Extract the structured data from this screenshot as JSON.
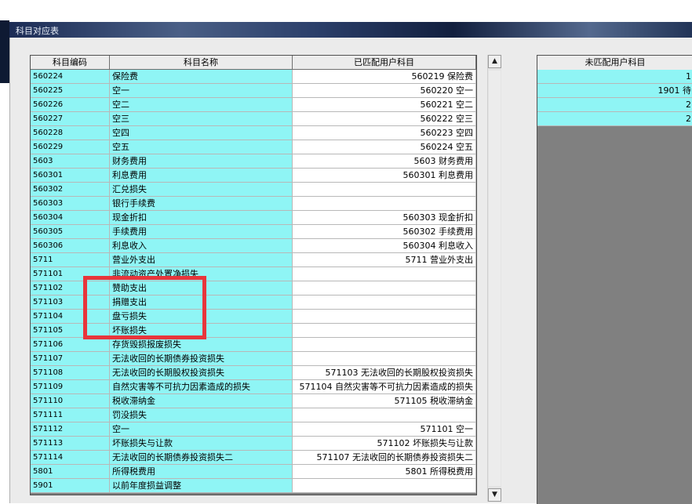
{
  "window": {
    "title": "科目对应表"
  },
  "left_table": {
    "headers": [
      "科目编码",
      "科目名称",
      "已匹配用户科目"
    ],
    "rows": [
      {
        "code": "560224",
        "name": "保险费",
        "matched": "560219 保险费"
      },
      {
        "code": "560225",
        "name": "空一",
        "matched": "560220 空一"
      },
      {
        "code": "560226",
        "name": "空二",
        "matched": "560221 空二"
      },
      {
        "code": "560227",
        "name": "空三",
        "matched": "560222 空三"
      },
      {
        "code": "560228",
        "name": "空四",
        "matched": "560223 空四"
      },
      {
        "code": "560229",
        "name": "空五",
        "matched": "560224 空五"
      },
      {
        "code": "5603",
        "name": "财务费用",
        "matched": "5603 财务费用"
      },
      {
        "code": "560301",
        "name": "利息费用",
        "matched": "560301 利息费用"
      },
      {
        "code": "560302",
        "name": "汇兑损失",
        "matched": ""
      },
      {
        "code": "560303",
        "name": "银行手续费",
        "matched": ""
      },
      {
        "code": "560304",
        "name": "现金折扣",
        "matched": "560303 现金折扣"
      },
      {
        "code": "560305",
        "name": "手续费用",
        "matched": "560302 手续费用"
      },
      {
        "code": "560306",
        "name": "利息收入",
        "matched": "560304 利息收入"
      },
      {
        "code": "5711",
        "name": "营业外支出",
        "matched": "5711 营业外支出"
      },
      {
        "code": "571101",
        "name": "非流动资产处置净损失",
        "matched": ""
      },
      {
        "code": "571102",
        "name": "赞助支出",
        "matched": ""
      },
      {
        "code": "571103",
        "name": "捐赠支出",
        "matched": ""
      },
      {
        "code": "571104",
        "name": "盘亏损失",
        "matched": ""
      },
      {
        "code": "571105",
        "name": "坏账损失",
        "matched": ""
      },
      {
        "code": "571106",
        "name": "存货毁损报废损失",
        "matched": ""
      },
      {
        "code": "571107",
        "name": "无法收回的长期债券投资损失",
        "matched": ""
      },
      {
        "code": "571108",
        "name": "无法收回的长期股权投资损失",
        "matched": "571103 无法收回的长期股权投资损失"
      },
      {
        "code": "571109",
        "name": "自然灾害等不可抗力因素造成的损失",
        "matched": "571104 自然灾害等不可抗力因素造成的损失"
      },
      {
        "code": "571110",
        "name": "税收滞纳金",
        "matched": "571105 税收滞纳金"
      },
      {
        "code": "571111",
        "name": "罚没损失",
        "matched": ""
      },
      {
        "code": "571112",
        "name": "空一",
        "matched": "571101 空一"
      },
      {
        "code": "571113",
        "name": "坏账损失与让款",
        "matched": "571102 坏账损失与让款"
      },
      {
        "code": "571114",
        "name": "无法收回的长期债券投资损失二",
        "matched": "571107 无法收回的长期债券投资损失二"
      },
      {
        "code": "5801",
        "name": "所得税费用",
        "matched": "5801 所得税费用"
      },
      {
        "code": "5901",
        "name": "以前年度损益调整",
        "matched": ""
      }
    ]
  },
  "scrollbar": {
    "up_icon": "▲",
    "down_icon": "▼"
  },
  "right_table": {
    "header": "未匹配用户科目",
    "rows": [
      "1",
      "1901 待",
      "2",
      "2"
    ]
  },
  "colors": {
    "cell_cyan": "#8ff5f5",
    "highlight_red": "#e8353b"
  }
}
